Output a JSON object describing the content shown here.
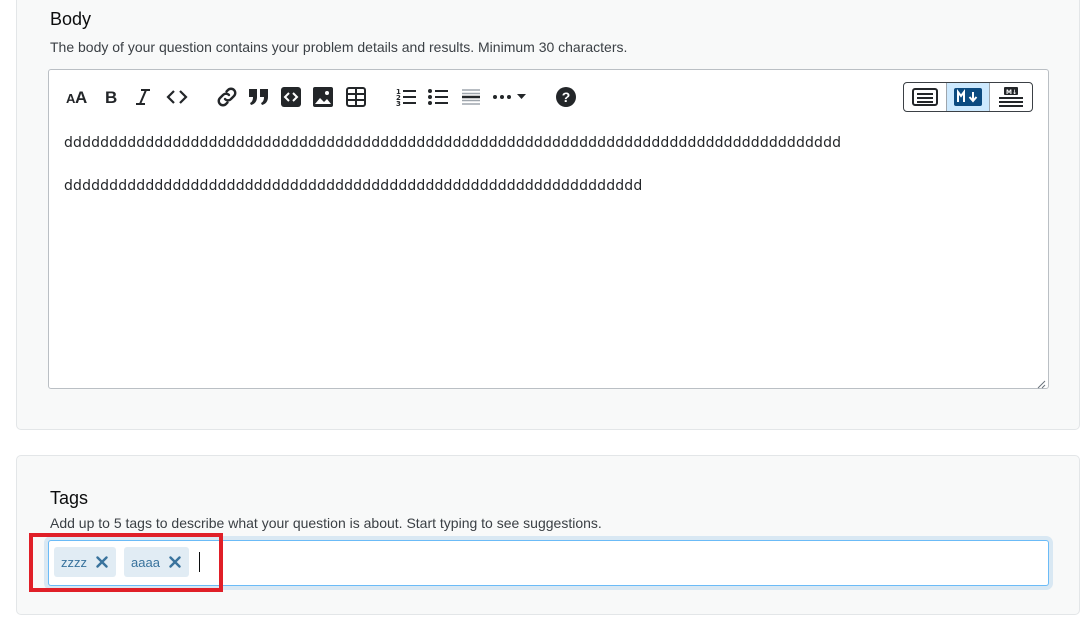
{
  "body_section": {
    "title": "Body",
    "description": "The body of your question contains your problem details and results. Minimum 30 characters."
  },
  "editor": {
    "toolbar": [
      {
        "name": "heading-icon",
        "label": "Heading"
      },
      {
        "name": "bold-icon",
        "label": "Bold"
      },
      {
        "name": "italic-icon",
        "label": "Italic"
      },
      {
        "name": "code-icon",
        "label": "Code"
      },
      {
        "name": "link-icon",
        "label": "Link"
      },
      {
        "name": "blockquote-icon",
        "label": "Blockquote"
      },
      {
        "name": "code-block-icon",
        "label": "Code block"
      },
      {
        "name": "image-icon",
        "label": "Image"
      },
      {
        "name": "table-icon",
        "label": "Table"
      },
      {
        "name": "ordered-list-icon",
        "label": "Numbered list"
      },
      {
        "name": "unordered-list-icon",
        "label": "Bulleted list"
      },
      {
        "name": "horizontal-rule-icon",
        "label": "Horizontal rule"
      },
      {
        "name": "more-icon",
        "label": "More"
      },
      {
        "name": "help-icon",
        "label": "Help"
      }
    ],
    "modes": [
      {
        "name": "rich-text-mode-icon",
        "active": false
      },
      {
        "name": "markdown-mode-icon",
        "active": true
      },
      {
        "name": "markdown-preview-mode-icon",
        "active": false
      }
    ],
    "content": [
      "dddddddddddddddddddddddddddddddddddddddddddddddddddddddddddddddddddddddddddddddddddddd",
      "dddddddddddddddddddddddddddddddddddddddddddddddddddddddddddddddd"
    ]
  },
  "tags_section": {
    "title": "Tags",
    "description": "Add up to 5 tags to describe what your question is about. Start typing to see suggestions.",
    "tags": [
      "zzzz",
      "aaaa"
    ]
  },
  "colors": {
    "tag_bg": "#e1ecf4",
    "tag_text": "#39739d",
    "focus_border": "#6bbbf7",
    "highlight": "#e01f28",
    "active_mode": "#cde9fe"
  }
}
